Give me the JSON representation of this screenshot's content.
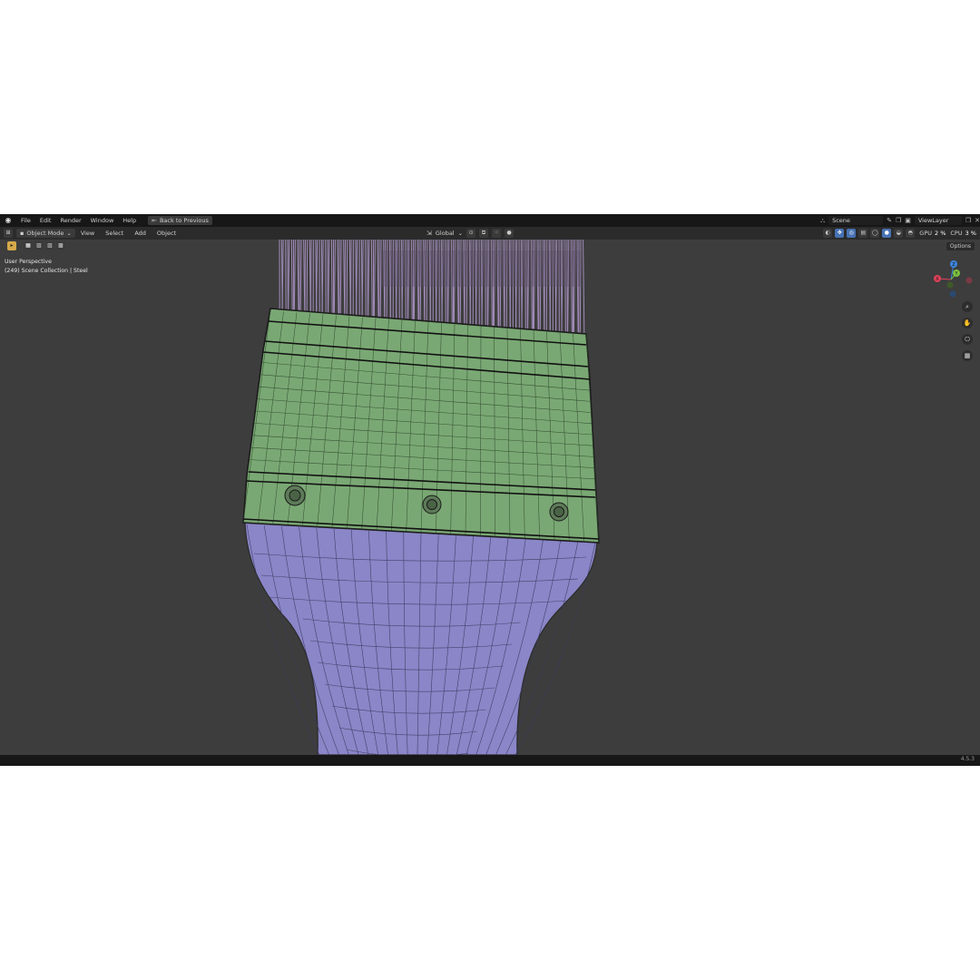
{
  "topbar": {
    "menus": [
      "File",
      "Edit",
      "Render",
      "Window",
      "Help"
    ],
    "back_button": "Back to Previous",
    "scene": "Scene",
    "view_layer": "ViewLayer",
    "gpu_label": "GPU",
    "gpu_value": "2 %",
    "cpu_label": "CPU",
    "cpu_value": "3 %"
  },
  "header": {
    "mode": "Object Mode",
    "menus": [
      "View",
      "Select",
      "Add",
      "Object"
    ],
    "transform_orientation": "Global",
    "options": "Options"
  },
  "viewport": {
    "perspective": "User Perspective",
    "collection": "(249) Scene Collection | Steel"
  },
  "gizmo": {
    "x": "X",
    "y": "Y",
    "z": "Z",
    "x_color": "#e0405a",
    "y_color": "#7cc240",
    "z_color": "#3f86e0"
  },
  "colors": {
    "ferrule": "#7aa874",
    "handle": "#8a86c8",
    "bristles": "#b49ad0",
    "background": "#3d3d3d"
  },
  "statusbar": {
    "version": "4.5.3"
  }
}
